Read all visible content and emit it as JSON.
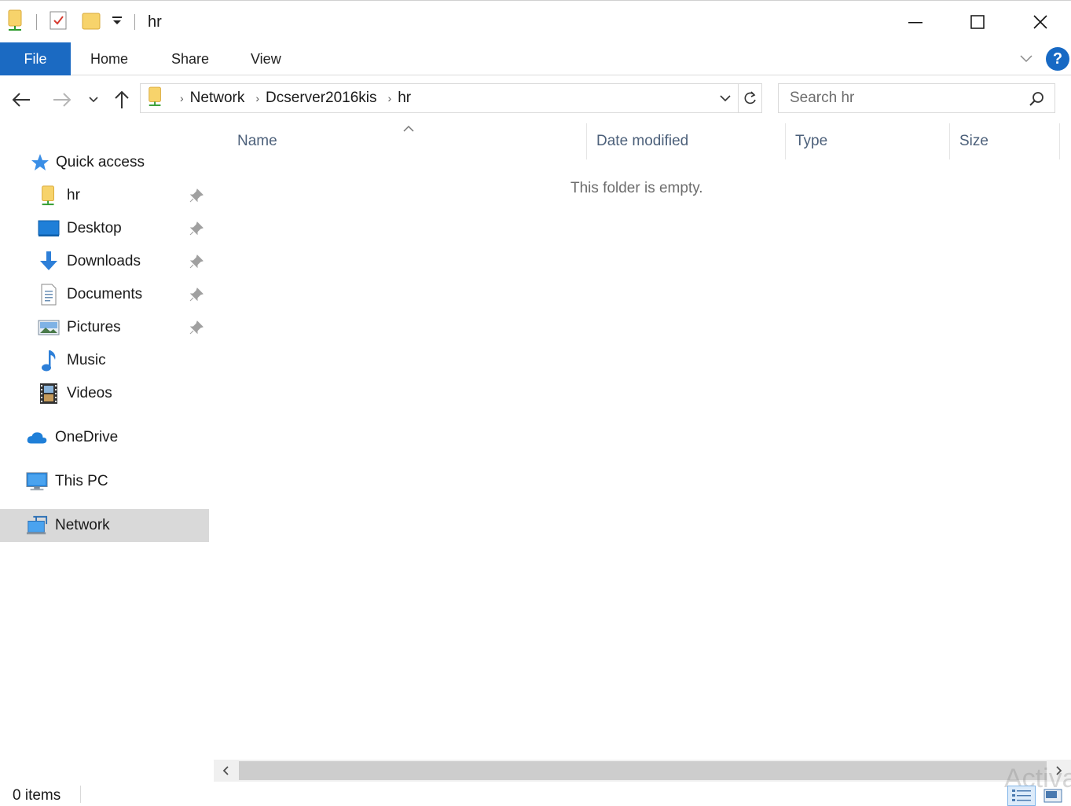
{
  "window": {
    "title": "hr",
    "minimize_label": "Minimize",
    "maximize_label": "Maximize",
    "close_label": "Close"
  },
  "ribbon": {
    "tabs": [
      "File",
      "Home",
      "Share",
      "View"
    ],
    "help_symbol": "?"
  },
  "address": {
    "breadcrumbs": [
      "Network",
      "Dcserver2016kis",
      "hr"
    ],
    "search_placeholder": "Search hr"
  },
  "sidebar": {
    "quick_access": "Quick access",
    "pinned": [
      "hr",
      "Desktop",
      "Downloads",
      "Documents",
      "Pictures"
    ],
    "unpinned": [
      "Music",
      "Videos"
    ],
    "onedrive": "OneDrive",
    "this_pc": "This PC",
    "network": "Network",
    "selected": "Network"
  },
  "content": {
    "columns": [
      "Name",
      "Date modified",
      "Type",
      "Size"
    ],
    "sorted_by": "Name",
    "empty_message": "This folder is empty."
  },
  "status": {
    "items": "0 items"
  },
  "watermark": "Activa",
  "colors": {
    "accent": "#1b6ac2",
    "selected_bg": "#d9d9d9",
    "column_header_text": "#4c607a",
    "help_blue": "#1769c4"
  }
}
